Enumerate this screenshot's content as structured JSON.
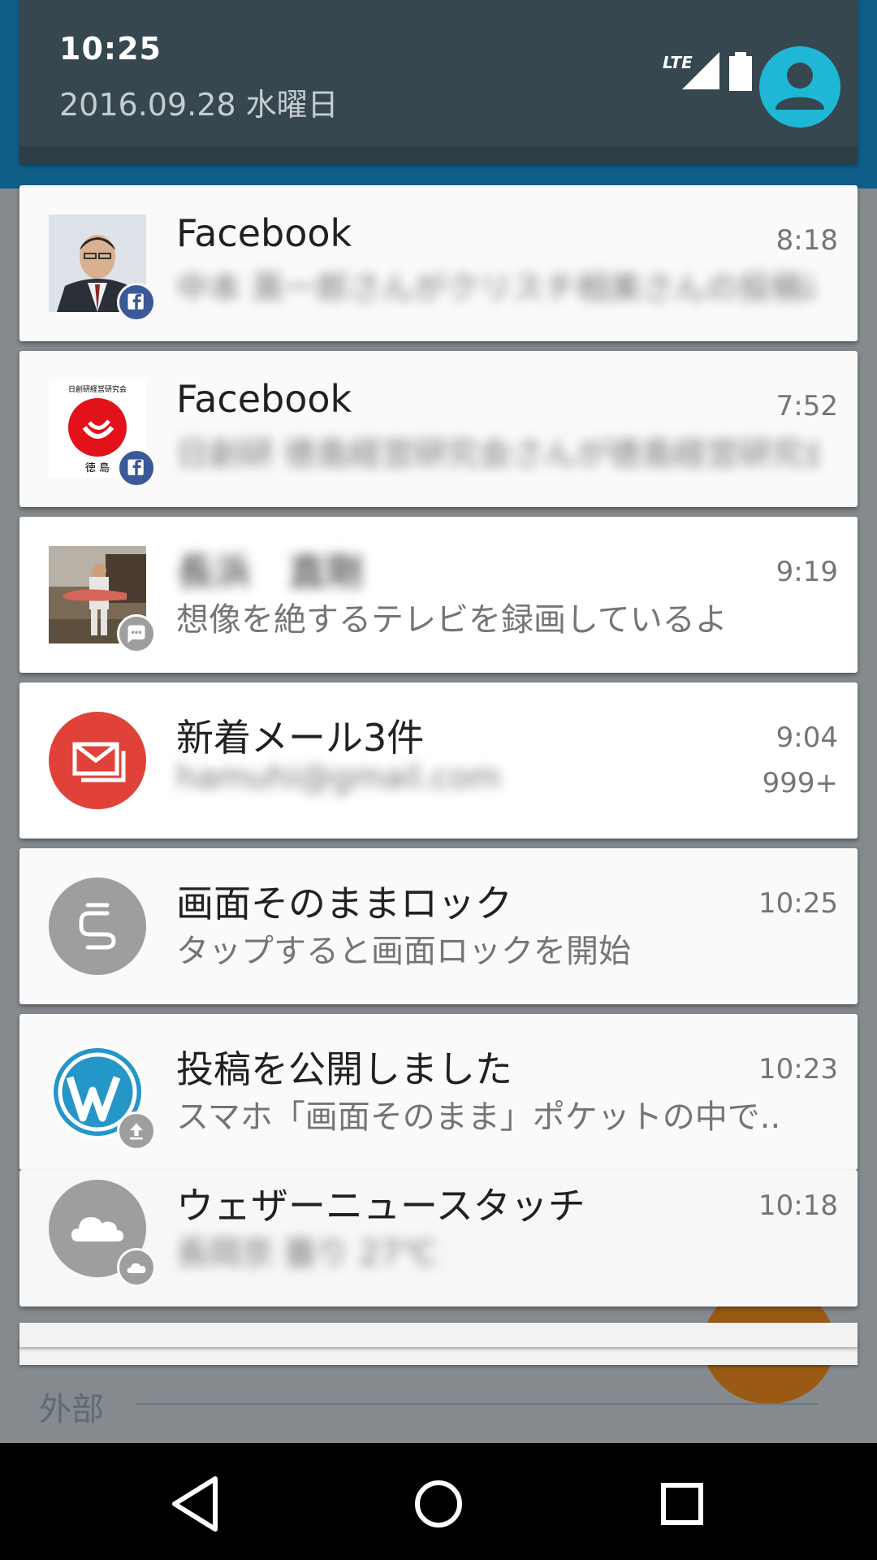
{
  "background": {
    "visible_label": "外部"
  },
  "status": {
    "time": "10:25",
    "date": "2016.09.28 水曜日",
    "network_label": "LTE",
    "icons": [
      "lte-signal-icon",
      "battery-icon",
      "user-avatar-icon"
    ]
  },
  "notifications": [
    {
      "app": "Facebook",
      "title": "Facebook",
      "time": "8:18",
      "text": "中本 英一郎さんがクリスチ相美さんの投稿にコメント",
      "icon": "profile-photo",
      "badge": "facebook-icon"
    },
    {
      "app": "Facebook",
      "title": "Facebook",
      "time": "7:52",
      "text": "日創研 徳島経営研究会さんが徳島経営研究会",
      "icon": "nisoken-logo",
      "badge": "facebook-icon",
      "logo_text_top": "日創研経営研究会",
      "logo_text_bottom": "徳  島"
    },
    {
      "app": "Message",
      "title": "長浜　直剛",
      "time": "9:19",
      "text": "想像を絶するテレビを録画しているよ",
      "icon": "profile-photo-fisherman",
      "badge": "chat-bubble-icon"
    },
    {
      "app": "Mail",
      "title": "新着メール3件",
      "time": "9:04",
      "text": "hamuhi@gmail.com",
      "count": "999+",
      "icon": "mail-icon"
    },
    {
      "app": "ScreenLock",
      "title": "画面そのままロック",
      "time": "10:25",
      "text": "タップすると画面ロックを開始",
      "icon": "lock-app-icon"
    },
    {
      "app": "WordPress",
      "title": "投稿を公開しました",
      "time": "10:23",
      "text": "スマホ「画面そのまま」ポケットの中で..",
      "icon": "wordpress-icon",
      "badge": "upload-icon"
    },
    {
      "app": "Weathernews",
      "title": "ウェザーニュースタッチ",
      "time": "10:18",
      "text": "長岡京 曇り 27℃",
      "icon": "cloud-icon",
      "badge": "cloud-icon"
    }
  ],
  "colors": {
    "facebook": "#3b5998",
    "mail_red": "#e0423a",
    "gray_icon": "#9e9e9e",
    "wordpress_blue": "#2596c8",
    "avatar_cyan": "#1eb8d6"
  },
  "nav": {
    "icons": [
      "back-icon",
      "home-icon",
      "recents-icon"
    ]
  }
}
